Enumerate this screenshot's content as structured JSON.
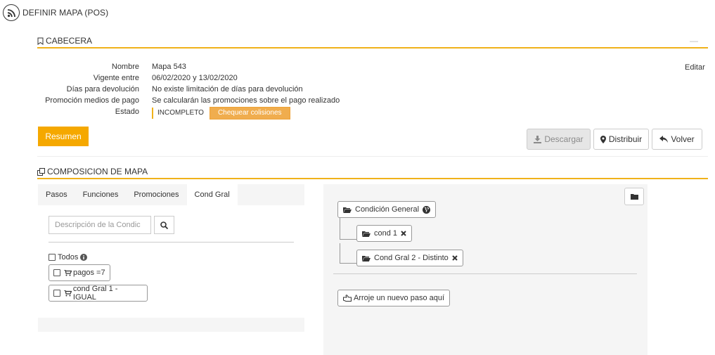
{
  "header": {
    "title": "DEFINIR MAPA (POS)",
    "icon": "rss-icon"
  },
  "cabecera": {
    "title": "CABECERA",
    "collapse_label": "—",
    "edit_label": "Editar",
    "fields": {
      "nombre_label": "Nombre",
      "nombre_value": "Mapa 543",
      "vigente_label": "Vigente entre",
      "vigente_value": "06/02/2020 y 13/02/2020",
      "dias_label": "Días para devolución",
      "dias_value": "No existe limitación de días para devolución",
      "promo_label": "Promoción medios de pago",
      "promo_value": "Se calcularán las promociones sobre el pago realizado",
      "estado_label": "Estado",
      "estado_value": "INCOMPLETO",
      "chequear_label": "Chequear colisiones"
    }
  },
  "actions": {
    "resumen": "Resumen",
    "descargar": "Descargar",
    "distribuir": "Distribuir",
    "volver": "Volver"
  },
  "composicion": {
    "title": "COMPOSICION DE MAPA",
    "tabs": [
      "Pasos",
      "Funciones",
      "Promociones",
      "Cond Gral"
    ],
    "active_tab": "Cond Gral",
    "search_placeholder": "Descripción de la Condic",
    "todos_label": "Todos",
    "items": [
      "pagos =7",
      "cond Gral 1 - IGUAL"
    ],
    "tree": {
      "root": "Condición General",
      "children": [
        "cond 1",
        "Cond Gral 2 - Distinto"
      ]
    },
    "drop_label": "Arroje un nuevo paso aquí"
  },
  "colors": {
    "accent": "#f0b21a",
    "resumen_bg": "#f5a800",
    "chequear_bg": "#f0ad4e"
  }
}
